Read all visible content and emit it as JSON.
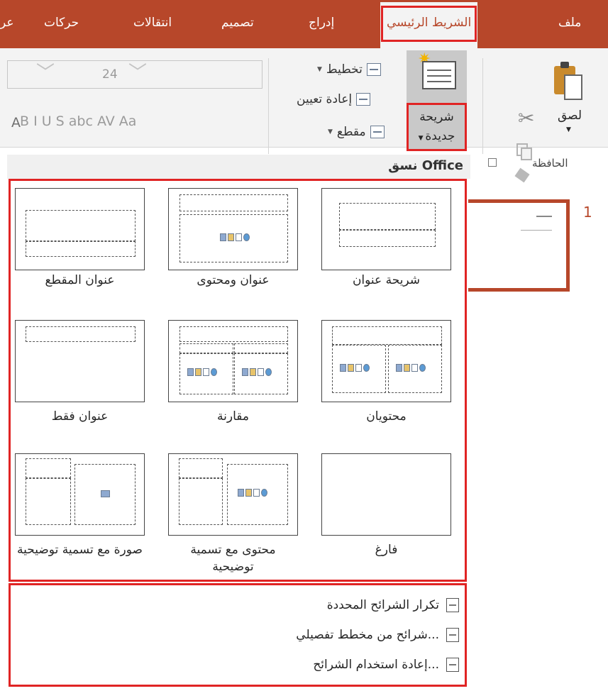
{
  "tabs": {
    "file": "ملف",
    "home": "الشريط الرئيسي",
    "insert": "إدراج",
    "design": "تصميم",
    "transitions": "انتقالات",
    "animations": "حركات",
    "slideshow": "عر"
  },
  "clipboard": {
    "paste": "لصق",
    "group_label": "الحافظة"
  },
  "slides_group": {
    "new_slide_line1": "شريحة",
    "new_slide_line2": "جديدة",
    "layout": "تخطيط",
    "reset": "إعادة تعيين",
    "section": "مقطع"
  },
  "font": {
    "size": "24",
    "grow_label": "A",
    "format_row": "B  I  U  S  abc  AV  Aa"
  },
  "gallery": {
    "title": "نسق Office",
    "layouts": [
      "شريحة عنوان",
      "عنوان ومحتوى",
      "عنوان المقطع",
      "محتويان",
      "مقارنة",
      "عنوان فقط",
      "فارغ",
      "محتوى مع تسمية توضيحية",
      "صورة مع تسمية توضيحية"
    ]
  },
  "menu": {
    "duplicate": "تكرار الشرائح المحددة",
    "from_outline": "شرائح من مخطط تفصيلي...",
    "reuse": "إعادة استخدام الشرائح..."
  },
  "slide_panel": {
    "number": "1"
  },
  "colors": {
    "brand": "#b7472a",
    "highlight": "#e02424"
  }
}
